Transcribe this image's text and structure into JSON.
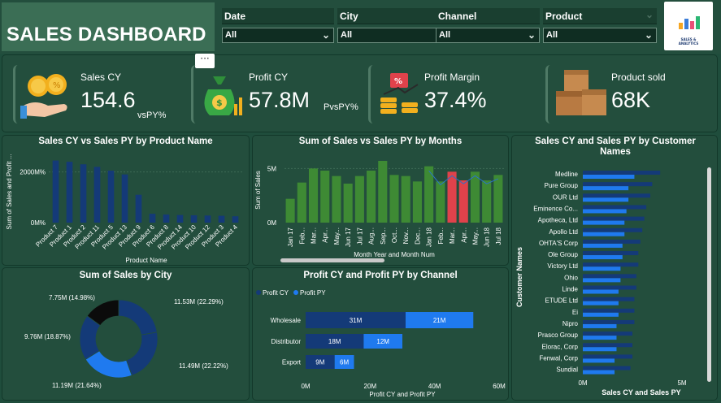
{
  "header": {
    "title": "SALES DASHBOARD",
    "filters": [
      {
        "label": "Date",
        "value": "All"
      },
      {
        "label": "City",
        "value": "All"
      },
      {
        "label": "Channel",
        "value": "All"
      },
      {
        "label": "Product",
        "value": "All"
      }
    ],
    "logo_text": "SALES & ANALYTICS"
  },
  "more_options": "···",
  "kpis": {
    "sales": {
      "label": "Sales CY",
      "value": "154.6",
      "sub": "vsPY%"
    },
    "profit": {
      "label": "Profit CY",
      "value": "57.8M",
      "sub": "PvsPY%"
    },
    "margin": {
      "label": "Profit Margin",
      "value": "37.4%"
    },
    "sold": {
      "label": "Product sold",
      "value": "68K"
    }
  },
  "colors": {
    "bg": "#1f4d3c",
    "panel": "#234e3d",
    "navy": "#143a78",
    "blue": "#1f7aef",
    "green": "#3e8a34",
    "red": "#e0424b",
    "black": "#0b0b0b"
  },
  "chart_data": [
    {
      "type": "bar",
      "title": "Sales CY vs Sales PY by Product Name",
      "ylabel": "Sum of Sales and Profit ...",
      "xlabel": "Product Name",
      "ylim": [
        0,
        2500
      ],
      "yticks": [
        "0M%",
        "2000M%"
      ],
      "categories": [
        "Product 7",
        "Product 1",
        "Product 2",
        "Product 11",
        "Product 5",
        "Product 13",
        "Product 9",
        "Product 6",
        "Product 8",
        "Product 14",
        "Product 10",
        "Product 12",
        "Product 3",
        "Product 4"
      ],
      "values": [
        2450,
        2400,
        2300,
        2200,
        2050,
        1900,
        1100,
        350,
        320,
        300,
        290,
        280,
        270,
        250
      ]
    },
    {
      "type": "bar",
      "title": "Sum of Sales vs Sales PY by Months",
      "ylabel": "Sum of Sales",
      "xlabel": "Month Year and Month Num",
      "ylim": [
        0,
        6
      ],
      "yticks": [
        "0M",
        "5M"
      ],
      "categories": [
        "Jan 17",
        "Feb...",
        "Mar...",
        "Apr...",
        "May...",
        "Jun 17",
        "Jul 17",
        "Aug...",
        "Sep...",
        "Oct...",
        "Nov...",
        "Dec...",
        "Jan 18",
        "Feb...",
        "Mar...",
        "Apr...",
        "May...",
        "Jun 18",
        "Jul 18"
      ],
      "values": [
        2.2,
        3.7,
        5.0,
        4.8,
        4.3,
        3.6,
        4.3,
        4.8,
        5.7,
        4.4,
        4.3,
        3.8,
        5.2,
        3.8,
        4.7,
        3.9,
        4.7,
        3.9,
        4.4
      ],
      "highlight": [
        14,
        15
      ]
    },
    {
      "type": "bar",
      "title": "Sales CY and Sales PY by Customer Names",
      "xlabel": "Sales CY and Sales PY",
      "ylabel": "Customer Names",
      "xlim": [
        0,
        5
      ],
      "xticks": [
        "0M",
        "5M"
      ],
      "categories": [
        "Medline",
        "Pure Group",
        "OUR Ltd",
        "Eminence Co...",
        "Apotheca, Ltd",
        "Apollo Ltd",
        "OHTA'S Corp",
        "Ole Group",
        "Victory Ltd",
        "Ohio",
        "Linde",
        "ETUDE Ltd",
        "Ei",
        "Nipro",
        "Prasco Group",
        "Elorac, Corp",
        "Fenwal, Corp",
        "Sundial"
      ],
      "series": [
        {
          "name": "Sales CY",
          "values": [
            2.6,
            2.3,
            2.3,
            2.2,
            2.1,
            2.1,
            2.0,
            2.0,
            1.9,
            1.9,
            1.8,
            1.8,
            1.8,
            1.7,
            1.7,
            1.7,
            1.6,
            1.6
          ]
        },
        {
          "name": "Sales PY",
          "values": [
            3.9,
            3.5,
            3.4,
            3.2,
            3.1,
            3.0,
            2.9,
            2.8,
            2.8,
            2.7,
            2.7,
            2.6,
            2.6,
            2.6,
            2.5,
            2.5,
            2.5,
            2.4
          ]
        }
      ]
    },
    {
      "type": "pie",
      "title": "Sum of Sales by City",
      "slices": [
        {
          "label": "11.53M (22.29%)",
          "value": 22.29,
          "color": "#143a78"
        },
        {
          "label": "11.49M (22.22%)",
          "value": 22.22,
          "color": "#143a78"
        },
        {
          "label": "11.19M (21.64%)",
          "value": 21.64,
          "color": "#1f7aef"
        },
        {
          "label": "9.76M (18.87%)",
          "value": 18.87,
          "color": "#143a78"
        },
        {
          "label": "7.75M (14.98%)",
          "value": 14.98,
          "color": "#0b0b0b"
        }
      ]
    },
    {
      "type": "bar",
      "title": "Profit CY and Profit PY by Channel",
      "xlabel": "Profit CY and Profit PY",
      "xlim": [
        0,
        60
      ],
      "xticks": [
        "0M",
        "20M",
        "40M",
        "60M"
      ],
      "categories": [
        "Wholesale",
        "Distributor",
        "Export"
      ],
      "series": [
        {
          "name": "Profit CY",
          "values": [
            31,
            18,
            9
          ],
          "labels": [
            "31M",
            "18M",
            "9M"
          ]
        },
        {
          "name": "Profit PY",
          "values": [
            21,
            12,
            6
          ],
          "labels": [
            "21M",
            "12M",
            "6M"
          ]
        }
      ]
    }
  ]
}
